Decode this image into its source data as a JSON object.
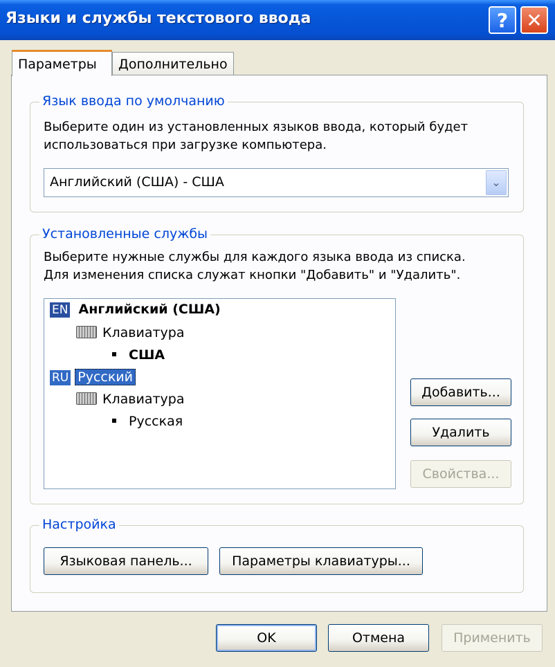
{
  "window": {
    "title": "Языки и службы текстового ввода",
    "help_glyph": "?",
    "close_glyph": "✕"
  },
  "tabs": [
    {
      "label": "Параметры"
    },
    {
      "label": "Дополнительно"
    }
  ],
  "default_language": {
    "legend": "Язык ввода по умолчанию",
    "description_line1": "Выберите один из установленных языков ввода, который будет",
    "description_line2": "использоваться при загрузке компьютера.",
    "selected": "Английский (США) - США",
    "dropdown_glyph": "⌄"
  },
  "installed_services": {
    "legend": "Установленные службы",
    "description_line1": "Выберите нужные службы для каждого языка ввода из списка.",
    "description_line2": "Для изменения списка служат кнопки \"Добавить\" и \"Удалить\".",
    "languages": [
      {
        "tag": "EN",
        "name": "Английский (США)",
        "group": "Клавиатура",
        "layout": "США"
      },
      {
        "tag": "RU",
        "name": "Русский",
        "group": "Клавиатура",
        "layout": "Русская"
      }
    ],
    "add_label": "Добавить...",
    "remove_label": "Удалить",
    "properties_label": "Свойства..."
  },
  "settings": {
    "legend": "Настройка",
    "language_bar_label": "Языковая панель...",
    "keyboard_settings_label": "Параметры клавиатуры..."
  },
  "footer": {
    "ok_label": "OK",
    "cancel_label": "Отмена",
    "apply_label": "Применить"
  }
}
